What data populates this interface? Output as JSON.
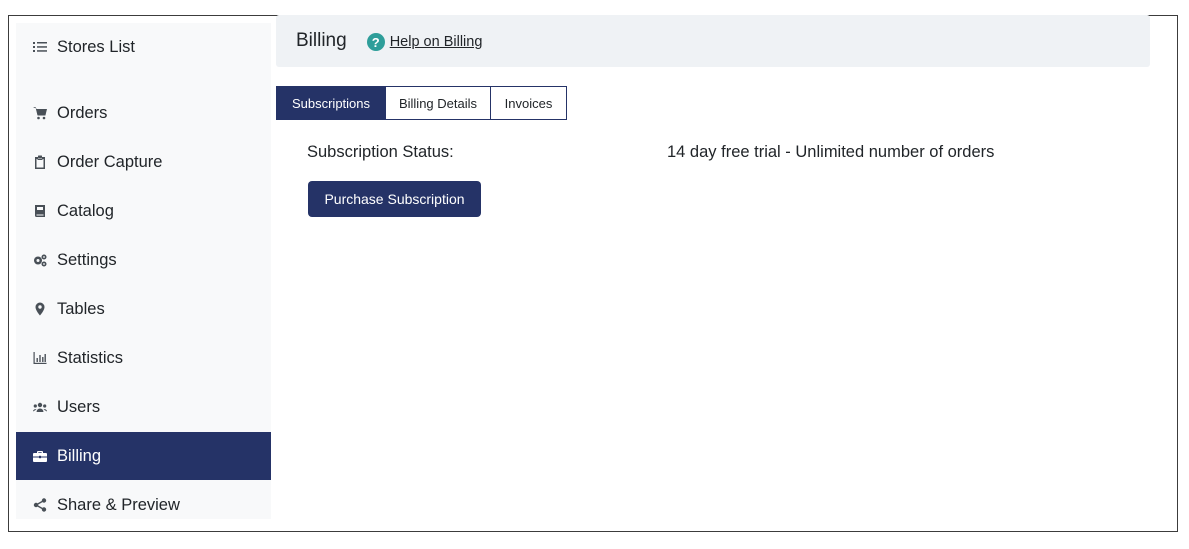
{
  "sidebar": {
    "items": [
      {
        "label": "Stores List",
        "icon": "list-icon"
      },
      {
        "label": "Orders",
        "icon": "cart-icon"
      },
      {
        "label": "Order Capture",
        "icon": "clipboard-icon"
      },
      {
        "label": "Catalog",
        "icon": "book-icon"
      },
      {
        "label": "Settings",
        "icon": "cogs-icon"
      },
      {
        "label": "Tables",
        "icon": "map-marker-icon"
      },
      {
        "label": "Statistics",
        "icon": "bar-chart-icon"
      },
      {
        "label": "Users",
        "icon": "users-icon"
      },
      {
        "label": "Billing",
        "icon": "briefcase-icon",
        "active": true
      },
      {
        "label": "Share & Preview",
        "icon": "share-icon"
      }
    ]
  },
  "header": {
    "title": "Billing",
    "help_icon": "question-circle-icon",
    "help_link": "Help on Billing"
  },
  "tabs": [
    {
      "label": "Subscriptions",
      "active": true
    },
    {
      "label": "Billing Details"
    },
    {
      "label": "Invoices"
    }
  ],
  "subscription": {
    "status_label": "Subscription Status:",
    "status_value": "14 day free trial - Unlimited number of orders",
    "purchase_button": "Purchase Subscription"
  },
  "colors": {
    "accent": "#253367",
    "help_icon": "#2e9e9a",
    "sidebar_bg": "#f8f9fa",
    "header_bg": "#eff2f5"
  }
}
